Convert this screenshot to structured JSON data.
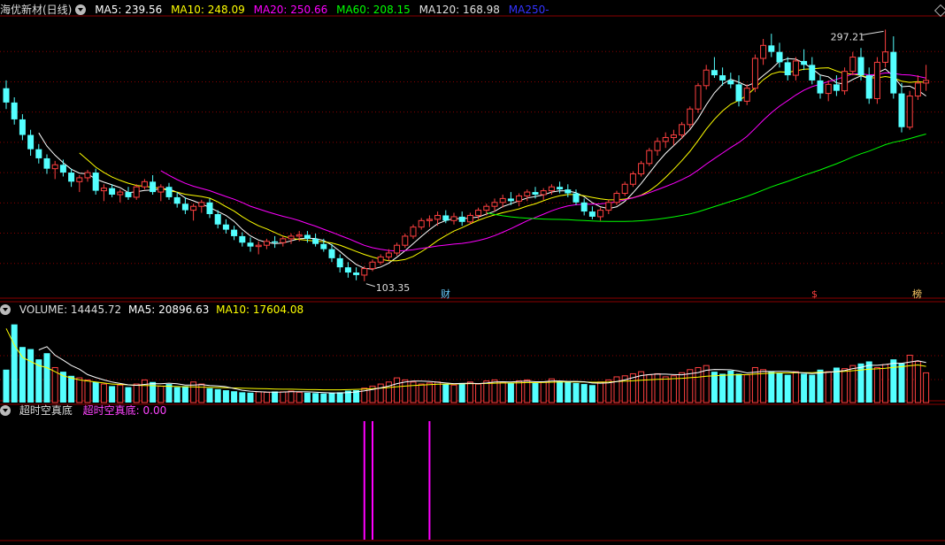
{
  "colors": {
    "up": "#ff4040",
    "down": "#54ffff",
    "ma5": "#ffffff",
    "ma10": "#ffff00",
    "ma20": "#ff00ff",
    "ma60": "#00ff00",
    "ma120": "#e0e0e0",
    "ma250": "#0000ff",
    "signal": "#ff00ff",
    "grid": "#8b0000"
  },
  "price_panel": {
    "title": "海优新材(日线)",
    "ma5": "MA5: 239.56",
    "ma10": "MA10: 248.09",
    "ma20": "MA20: 250.66",
    "ma60": "MA60: 208.15",
    "ma120": "MA120: 168.98",
    "ma250": "MA250",
    "ma250_suffix": "-",
    "high_label": "297.21",
    "low_label": "103.35",
    "marker_cai": "财",
    "marker_dollar": "$",
    "marker_bang": "榜"
  },
  "volume_panel": {
    "label": "VOLUME: 14445.72",
    "ma5": "MA5: 20896.63",
    "ma10": "MA10: 17604.08"
  },
  "signal_panel": {
    "title": "超时空真底",
    "value": "超时空真底: 0.00"
  },
  "chart_data": {
    "type": "candlestick",
    "ylim": [
      100,
      300
    ],
    "high": 297.21,
    "low": 103.35,
    "candles": [
      [
        252,
        258,
        236,
        241
      ],
      [
        241,
        245,
        224,
        228
      ],
      [
        228,
        232,
        212,
        216
      ],
      [
        216,
        220,
        200,
        205
      ],
      [
        205,
        209,
        194,
        198
      ],
      [
        198,
        201,
        186,
        190
      ],
      [
        190,
        196,
        182,
        193
      ],
      [
        193,
        197,
        184,
        187
      ],
      [
        187,
        190,
        176,
        180
      ],
      [
        180,
        185,
        172,
        183
      ],
      [
        183,
        189,
        180,
        187
      ],
      [
        187,
        190,
        170,
        173
      ],
      [
        173,
        178,
        165,
        175
      ],
      [
        175,
        178,
        168,
        170
      ],
      [
        170,
        174,
        164,
        172
      ],
      [
        172,
        176,
        166,
        168
      ],
      [
        168,
        178,
        166,
        176
      ],
      [
        176,
        182,
        174,
        180
      ],
      [
        180,
        185,
        170,
        172
      ],
      [
        172,
        178,
        165,
        176
      ],
      [
        176,
        179,
        166,
        168
      ],
      [
        168,
        172,
        160,
        163
      ],
      [
        163,
        168,
        155,
        158
      ],
      [
        158,
        163,
        150,
        161
      ],
      [
        161,
        166,
        156,
        164
      ],
      [
        164,
        167,
        152,
        155
      ],
      [
        155,
        158,
        144,
        147
      ],
      [
        147,
        151,
        140,
        143
      ],
      [
        143,
        146,
        135,
        138
      ],
      [
        138,
        141,
        130,
        133
      ],
      [
        133,
        137,
        126,
        130
      ],
      [
        130,
        134,
        124,
        131
      ],
      [
        131,
        136,
        128,
        134
      ],
      [
        134,
        138,
        129,
        133
      ],
      [
        133,
        138,
        130,
        136
      ],
      [
        136,
        140,
        132,
        138
      ],
      [
        138,
        142,
        134,
        139
      ],
      [
        139,
        142,
        133,
        136
      ],
      [
        136,
        140,
        130,
        132
      ],
      [
        132,
        136,
        126,
        128
      ],
      [
        128,
        132,
        118,
        121
      ],
      [
        121,
        124,
        110,
        114
      ],
      [
        114,
        118,
        106,
        110
      ],
      [
        110,
        114,
        104,
        108
      ],
      [
        108,
        115,
        103.35,
        113
      ],
      [
        113,
        120,
        111,
        118
      ],
      [
        118,
        124,
        116,
        122
      ],
      [
        122,
        128,
        119,
        125
      ],
      [
        125,
        133,
        123,
        131
      ],
      [
        131,
        140,
        129,
        138
      ],
      [
        138,
        147,
        136,
        145
      ],
      [
        145,
        152,
        143,
        150
      ],
      [
        150,
        154,
        145,
        151
      ],
      [
        151,
        157,
        146,
        154
      ],
      [
        154,
        158,
        148,
        150
      ],
      [
        150,
        156,
        147,
        153
      ],
      [
        153,
        157,
        146,
        149
      ],
      [
        149,
        156,
        147,
        154
      ],
      [
        154,
        160,
        151,
        158
      ],
      [
        158,
        163,
        154,
        161
      ],
      [
        161,
        167,
        157,
        164
      ],
      [
        164,
        170,
        160,
        167
      ],
      [
        167,
        172,
        162,
        165
      ],
      [
        165,
        171,
        161,
        169
      ],
      [
        169,
        174,
        165,
        172
      ],
      [
        172,
        176,
        167,
        170
      ],
      [
        170,
        175,
        166,
        173
      ],
      [
        173,
        178,
        170,
        176
      ],
      [
        176,
        180,
        171,
        174
      ],
      [
        174,
        178,
        168,
        171
      ],
      [
        171,
        174,
        162,
        164
      ],
      [
        164,
        167,
        154,
        157
      ],
      [
        157,
        161,
        151,
        153
      ],
      [
        153,
        160,
        150,
        158
      ],
      [
        158,
        166,
        155,
        164
      ],
      [
        164,
        173,
        162,
        171
      ],
      [
        171,
        180,
        169,
        178
      ],
      [
        178,
        188,
        176,
        186
      ],
      [
        186,
        196,
        184,
        194
      ],
      [
        194,
        206,
        192,
        204
      ],
      [
        204,
        214,
        200,
        211
      ],
      [
        211,
        218,
        206,
        214
      ],
      [
        214,
        220,
        208,
        216
      ],
      [
        216,
        226,
        213,
        224
      ],
      [
        224,
        238,
        221,
        236
      ],
      [
        236,
        256,
        233,
        254
      ],
      [
        254,
        270,
        251,
        266
      ],
      [
        266,
        276,
        260,
        262
      ],
      [
        262,
        268,
        254,
        258
      ],
      [
        258,
        264,
        252,
        255
      ],
      [
        255,
        262,
        238,
        242
      ],
      [
        242,
        255,
        239,
        252
      ],
      [
        252,
        278,
        249,
        275
      ],
      [
        275,
        290,
        270,
        285
      ],
      [
        285,
        294,
        276,
        280
      ],
      [
        280,
        287,
        268,
        272
      ],
      [
        272,
        276,
        258,
        262
      ],
      [
        262,
        276,
        258,
        273
      ],
      [
        273,
        282,
        266,
        270
      ],
      [
        270,
        276,
        255,
        258
      ],
      [
        258,
        262,
        244,
        248
      ],
      [
        248,
        258,
        242,
        255
      ],
      [
        255,
        262,
        246,
        250
      ],
      [
        250,
        268,
        247,
        265
      ],
      [
        265,
        280,
        262,
        276
      ],
      [
        276,
        283,
        258,
        262
      ],
      [
        262,
        268,
        240,
        244
      ],
      [
        244,
        276,
        240,
        272
      ],
      [
        272,
        297.21,
        268,
        280
      ],
      [
        280,
        292,
        244,
        248
      ],
      [
        248,
        256,
        218,
        222
      ],
      [
        222,
        250,
        220,
        246
      ],
      [
        246,
        262,
        243,
        256
      ],
      [
        256,
        270,
        250,
        258
      ]
    ],
    "volume": [
      [
        16000,
        36000
      ],
      [
        38000,
        28000
      ],
      [
        27000,
        22000
      ],
      [
        26000,
        20000
      ],
      [
        21000,
        18000
      ],
      [
        24000,
        17000
      ],
      [
        17000,
        15000
      ],
      [
        15000,
        13000
      ],
      [
        13000,
        12000
      ],
      [
        12000,
        11000
      ],
      [
        11000,
        10500
      ],
      [
        10000,
        10000
      ],
      [
        9000,
        9500
      ],
      [
        8000,
        9000
      ],
      [
        8500,
        8800
      ],
      [
        7500,
        8600
      ],
      [
        9000,
        8400
      ],
      [
        11000,
        8300
      ],
      [
        10000,
        8200
      ],
      [
        8000,
        8000
      ],
      [
        9000,
        7900
      ],
      [
        7500,
        7800
      ],
      [
        8000,
        7700
      ],
      [
        10000,
        7600
      ],
      [
        9000,
        7500
      ],
      [
        7000,
        7400
      ],
      [
        6500,
        7300
      ],
      [
        6000,
        7200
      ],
      [
        5500,
        7100
      ],
      [
        5000,
        7000
      ],
      [
        4800,
        6900
      ],
      [
        5200,
        6800
      ],
      [
        5000,
        6700
      ],
      [
        5400,
        6600
      ],
      [
        5200,
        6500
      ],
      [
        5600,
        6500
      ],
      [
        5000,
        6400
      ],
      [
        4800,
        6300
      ],
      [
        4600,
        6300
      ],
      [
        4400,
        6200
      ],
      [
        4600,
        6200
      ],
      [
        5000,
        6200
      ],
      [
        5800,
        6300
      ],
      [
        6000,
        6400
      ],
      [
        7000,
        6600
      ],
      [
        8000,
        6800
      ],
      [
        9000,
        7000
      ],
      [
        10000,
        7300
      ],
      [
        12000,
        7700
      ],
      [
        11000,
        8000
      ],
      [
        10000,
        8300
      ],
      [
        9000,
        8500
      ],
      [
        9500,
        8700
      ],
      [
        10000,
        8900
      ],
      [
        9000,
        9000
      ],
      [
        8500,
        9000
      ],
      [
        9500,
        9100
      ],
      [
        10000,
        9200
      ],
      [
        9000,
        9200
      ],
      [
        10500,
        9300
      ],
      [
        11000,
        9400
      ],
      [
        10000,
        9500
      ],
      [
        9500,
        9500
      ],
      [
        10500,
        9600
      ],
      [
        11000,
        9700
      ],
      [
        9500,
        9700
      ],
      [
        10000,
        9800
      ],
      [
        11500,
        9900
      ],
      [
        10500,
        10000
      ],
      [
        10000,
        10000
      ],
      [
        9500,
        10000
      ],
      [
        9000,
        10000
      ],
      [
        8500,
        9900
      ],
      [
        10000,
        9900
      ],
      [
        11000,
        10000
      ],
      [
        12500,
        10200
      ],
      [
        13000,
        10400
      ],
      [
        14000,
        10600
      ],
      [
        15000,
        10900
      ],
      [
        13500,
        11100
      ],
      [
        14000,
        11300
      ],
      [
        12500,
        11400
      ],
      [
        13000,
        11600
      ],
      [
        14500,
        11800
      ],
      [
        16000,
        12100
      ],
      [
        17000,
        12400
      ],
      [
        18000,
        12800
      ],
      [
        15000,
        13000
      ],
      [
        14000,
        13200
      ],
      [
        15500,
        13400
      ],
      [
        14000,
        13500
      ],
      [
        13500,
        13600
      ],
      [
        17000,
        13900
      ],
      [
        16000,
        14100
      ],
      [
        15000,
        14300
      ],
      [
        14500,
        14400
      ],
      [
        13500,
        14400
      ],
      [
        15000,
        14500
      ],
      [
        14000,
        14500
      ],
      [
        13500,
        14500
      ],
      [
        16000,
        14700
      ],
      [
        15000,
        14800
      ],
      [
        17000,
        15000
      ],
      [
        16500,
        15200
      ],
      [
        18000,
        15500
      ],
      [
        19000,
        15800
      ],
      [
        20000,
        16200
      ],
      [
        17000,
        16400
      ],
      [
        18500,
        16700
      ],
      [
        21000,
        17100
      ],
      [
        19000,
        17400
      ],
      [
        23000,
        17900
      ],
      [
        20000,
        18300
      ],
      [
        14445.72,
        17604.08
      ]
    ],
    "signal_bars": [
      44,
      45,
      52
    ],
    "signal_value": 0.0
  }
}
